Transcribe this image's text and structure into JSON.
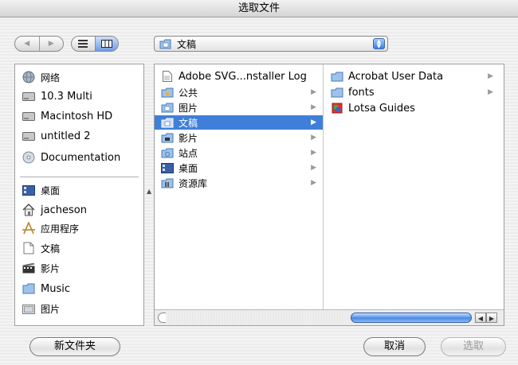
{
  "window": {
    "title": "选取文件"
  },
  "toolbar": {
    "back_glyph": "◀",
    "forward_glyph": "▶",
    "location_popup": "文稿"
  },
  "sidebar": {
    "devices": [
      {
        "label": "网络",
        "icon": "network-globe-icon"
      },
      {
        "label": "10.3 Multi",
        "icon": "hard-disk-icon"
      },
      {
        "label": "Macintosh HD",
        "icon": "hard-disk-icon"
      },
      {
        "label": "untitled 2",
        "icon": "hard-disk-icon"
      },
      {
        "label": "Documentation",
        "icon": "cd-disc-icon"
      }
    ],
    "places": [
      {
        "label": "桌面",
        "icon": "desktop-icon"
      },
      {
        "label": "jacheson",
        "icon": "home-icon"
      },
      {
        "label": "应用程序",
        "icon": "applications-icon"
      },
      {
        "label": "文稿",
        "icon": "documents-icon"
      },
      {
        "label": "影片",
        "icon": "movies-icon"
      },
      {
        "label": "Music",
        "icon": "music-folder-icon"
      },
      {
        "label": "图片",
        "icon": "pictures-icon"
      }
    ]
  },
  "browser": {
    "column1": [
      {
        "label": "Adobe SVG...nstaller Log",
        "icon": "document-icon",
        "has_children": false,
        "selected": false
      },
      {
        "label": "公共",
        "icon": "public-folder-icon",
        "has_children": true,
        "selected": false
      },
      {
        "label": "图片",
        "icon": "pictures-folder-icon",
        "has_children": true,
        "selected": false
      },
      {
        "label": "文稿",
        "icon": "documents-folder-icon",
        "has_children": true,
        "selected": true
      },
      {
        "label": "影片",
        "icon": "movies-folder-icon",
        "has_children": true,
        "selected": false
      },
      {
        "label": "站点",
        "icon": "sites-folder-icon",
        "has_children": true,
        "selected": false
      },
      {
        "label": "桌面",
        "icon": "desktop-folder-icon",
        "has_children": true,
        "selected": false
      },
      {
        "label": "资源库",
        "icon": "library-folder-icon",
        "has_children": true,
        "selected": false
      }
    ],
    "column2": [
      {
        "label": "Acrobat User Data",
        "icon": "folder-icon",
        "has_children": true
      },
      {
        "label": "fonts",
        "icon": "folder-icon",
        "has_children": true
      },
      {
        "label": "Lotsa Guides",
        "icon": "application-document-icon",
        "has_children": false
      }
    ],
    "chevron_glyph": "▶"
  },
  "buttons": {
    "new_folder": "新文件夹",
    "cancel": "取消",
    "choose": "选取"
  },
  "colors": {
    "selection": "#3f7fd9",
    "aqua_blue": "#4b8ae6"
  }
}
